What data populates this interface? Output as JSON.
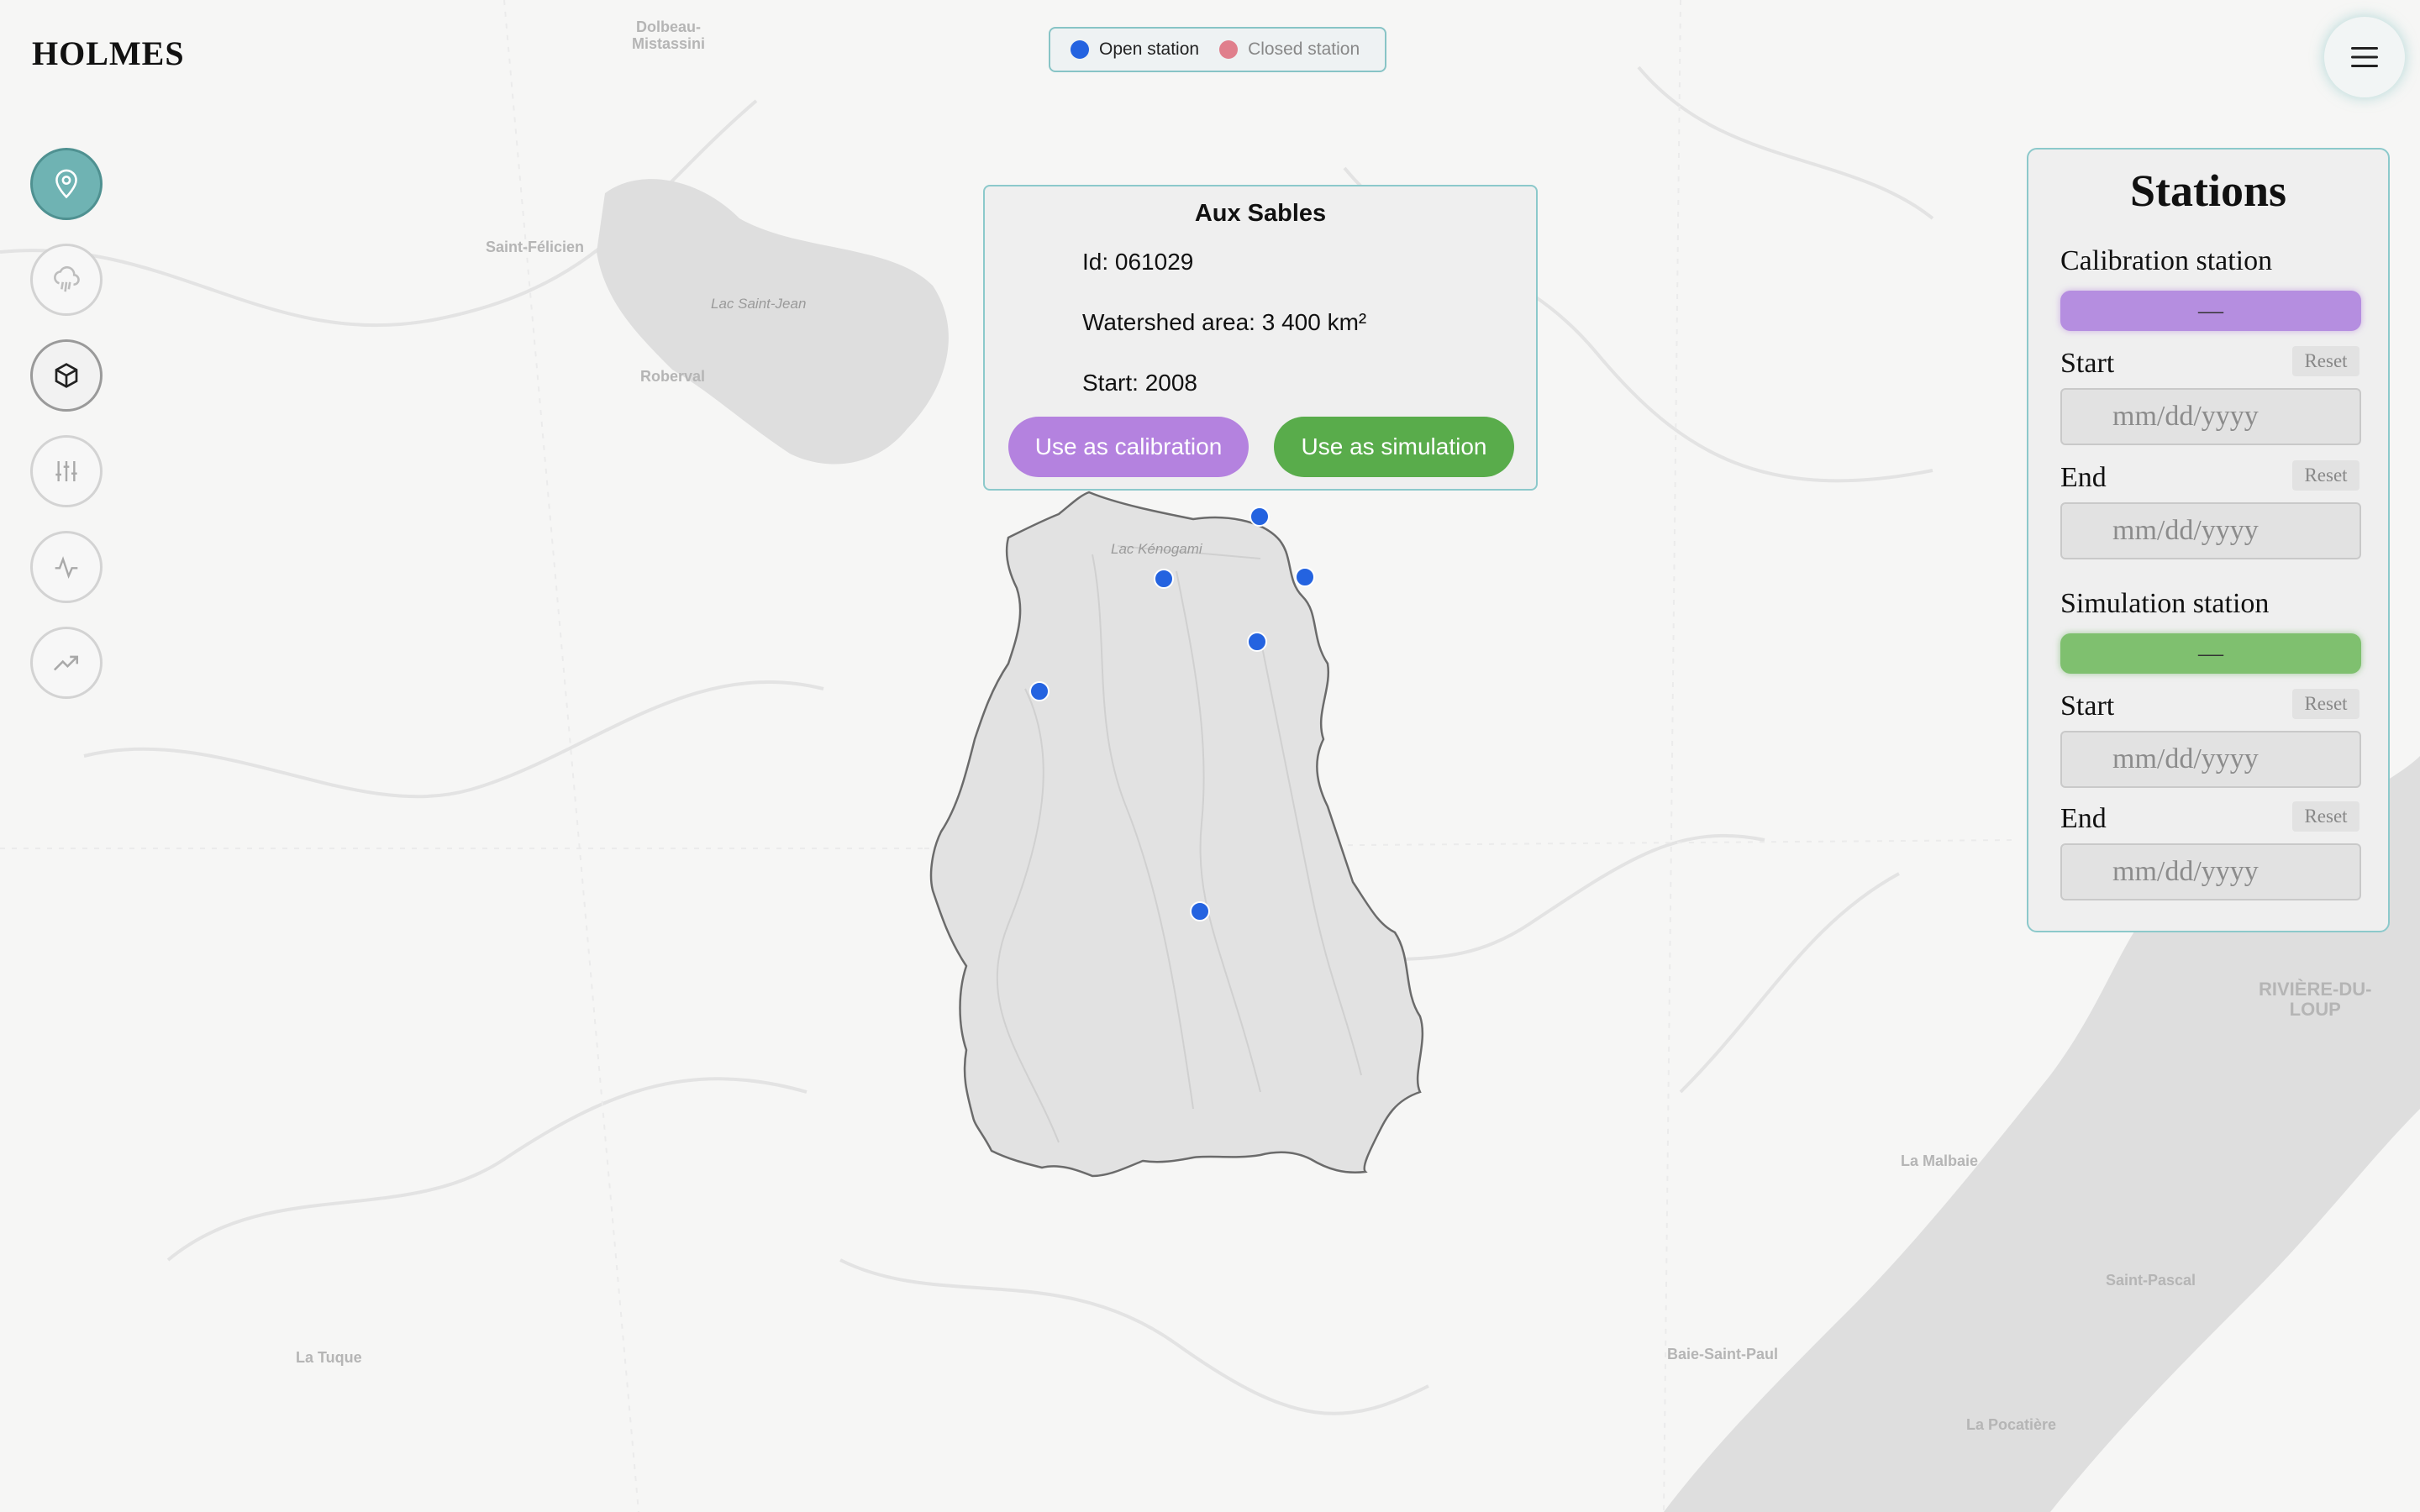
{
  "app": {
    "brand": "HOLMES"
  },
  "colors": {
    "open_station": "#2463e0",
    "closed_station": "#e07f8c",
    "calibration": "#b482df",
    "simulation": "#59ac4b",
    "accent": "#6fb3b3"
  },
  "legend": {
    "open_label": "Open station",
    "closed_label": "Closed station"
  },
  "toolbar": {
    "items": [
      {
        "icon": "map-pin-icon",
        "state": "active"
      },
      {
        "icon": "rain-cloud-icon",
        "state": "default"
      },
      {
        "icon": "cube-icon",
        "state": "selected"
      },
      {
        "icon": "sliders-icon",
        "state": "default"
      },
      {
        "icon": "pulse-icon",
        "state": "default"
      },
      {
        "icon": "trending-up-icon",
        "state": "default"
      }
    ]
  },
  "menu": {
    "icon": "hamburger-menu-icon"
  },
  "map": {
    "places": [
      {
        "name": "Dolbeau-\nMistassini"
      },
      {
        "name": "Saint-Félicien"
      },
      {
        "name": "Lac Saint-Jean"
      },
      {
        "name": "Roberval"
      },
      {
        "name": "Lac Kénogami"
      },
      {
        "name": "RIVIÈRE-DU-\nLOUP"
      },
      {
        "name": "La Malbaie"
      },
      {
        "name": "Saint-Pascal"
      },
      {
        "name": "La Tuque"
      },
      {
        "name": "Baie-Saint-Paul"
      },
      {
        "name": "La Pocatière"
      }
    ],
    "stations": [
      {
        "status": "open"
      },
      {
        "status": "open"
      },
      {
        "status": "open"
      },
      {
        "status": "open"
      },
      {
        "status": "open"
      },
      {
        "status": "open"
      }
    ]
  },
  "popup": {
    "title": "Aux Sables",
    "id_line": "Id: 061029",
    "area_line": "Watershed area: 3 400 km²",
    "start_line": "Start: 2008",
    "calibration_button": "Use as calibration",
    "simulation_button": "Use as simulation"
  },
  "panel": {
    "title": "Stations",
    "calibration": {
      "label": "Calibration station",
      "value": "—",
      "start_label": "Start",
      "end_label": "End",
      "reset_label": "Reset",
      "start_placeholder": "mm/dd/yyyy",
      "end_placeholder": "mm/dd/yyyy"
    },
    "simulation": {
      "label": "Simulation station",
      "value": "—",
      "start_label": "Start",
      "end_label": "End",
      "reset_label": "Reset",
      "start_placeholder": "mm/dd/yyyy",
      "end_placeholder": "mm/dd/yyyy"
    }
  }
}
